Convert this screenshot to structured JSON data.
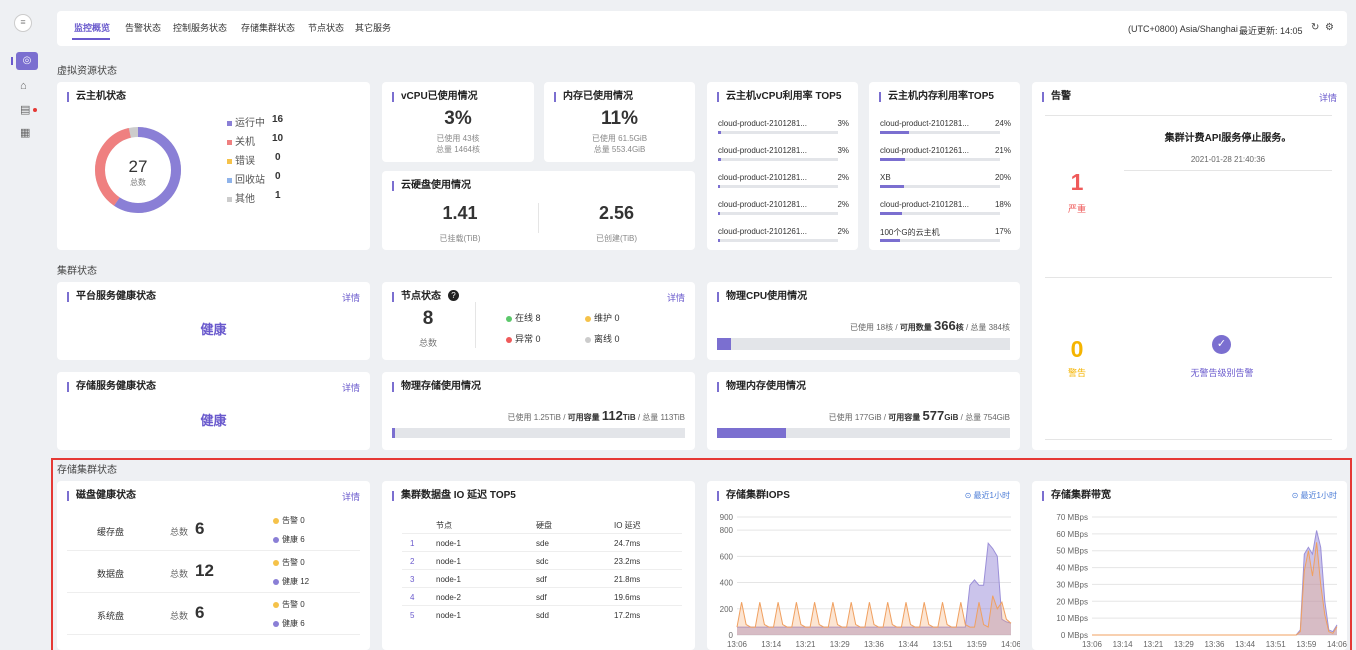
{
  "nav": {
    "tabs": [
      "监控概览",
      "告警状态",
      "控制服务状态",
      "存储集群状态",
      "节点状态",
      "其它服务"
    ],
    "timezone": "(UTC+0800) Asia/Shanghai",
    "update_label": "最近更新: 14:05"
  },
  "sections": {
    "virtual": "虚拟资源状态",
    "cluster": "集群状态",
    "storage": "存储集群状态"
  },
  "vm": {
    "title": "云主机状态",
    "total": "27",
    "total_label": "总数",
    "legend": [
      {
        "label": "运行中",
        "value": "16",
        "color": "#8a7fd6"
      },
      {
        "label": "关机",
        "value": "10",
        "color": "#ef8080"
      },
      {
        "label": "错误",
        "value": "0",
        "color": "#f5c24a"
      },
      {
        "label": "回收站",
        "value": "0",
        "color": "#8fb3ea"
      },
      {
        "label": "其他",
        "value": "1",
        "color": "#cccccc"
      }
    ]
  },
  "vcpu": {
    "title": "vCPU已使用情况",
    "pct": "3%",
    "used": "已使用 43核",
    "total": "总量 1464核"
  },
  "mem": {
    "title": "内存已使用情况",
    "pct": "11%",
    "used": "已使用 61.5GiB",
    "total": "总量 553.4GiB"
  },
  "disk": {
    "title": "云硬盘使用情况",
    "mounted": "1.41",
    "mounted_label": "已挂载(TiB)",
    "created": "2.56",
    "created_label": "已创建(TiB)"
  },
  "top_cpu": {
    "title": "云主机vCPU利用率 TOP5",
    "items": [
      {
        "name": "cloud-product-2101281...",
        "pct": "3%",
        "frac": 0.03
      },
      {
        "name": "cloud-product-2101281...",
        "pct": "3%",
        "frac": 0.03
      },
      {
        "name": "cloud-product-2101281...",
        "pct": "2%",
        "frac": 0.02
      },
      {
        "name": "cloud-product-2101281...",
        "pct": "2%",
        "frac": 0.02
      },
      {
        "name": "cloud-product-2101261...",
        "pct": "2%",
        "frac": 0.02
      }
    ]
  },
  "top_mem": {
    "title": "云主机内存利用率TOP5",
    "items": [
      {
        "name": "cloud-product-2101281...",
        "pct": "24%",
        "frac": 0.24
      },
      {
        "name": "cloud-product-2101261...",
        "pct": "21%",
        "frac": 0.21
      },
      {
        "name": "XB",
        "pct": "20%",
        "frac": 0.2
      },
      {
        "name": "cloud-product-2101281...",
        "pct": "18%",
        "frac": 0.18
      },
      {
        "name": "100个G的云主机",
        "pct": "17%",
        "frac": 0.17
      }
    ]
  },
  "alarm": {
    "title": "告警",
    "detail": "详情",
    "severe_count": "1",
    "severe_label": "严重",
    "message": "集群计费API服务停止服务。",
    "time": "2021-01-28 21:40:36",
    "warn_count": "0",
    "warn_label": "警告",
    "no_warn": "无警告级别告警"
  },
  "platform": {
    "title": "平台服务健康状态",
    "detail": "详情",
    "status": "健康"
  },
  "storage_svc": {
    "title": "存储服务健康状态",
    "detail": "详情",
    "status": "健康"
  },
  "node": {
    "title": "节点状态",
    "detail": "详情",
    "total": "8",
    "total_label": "总数",
    "online": "在线 8",
    "maintain": "维护 0",
    "abnormal": "异常 0",
    "offline": "离线 0"
  },
  "pcpu": {
    "title": "物理CPU使用情况",
    "used": "已使用 18核 / ",
    "avail_label": "可用数量 ",
    "avail": "366",
    "avail_unit": "核",
    "total": " / 总量 384核",
    "frac": 0.047
  },
  "pstore": {
    "title": "物理存储使用情况",
    "used": "已使用 1.25TiB / ",
    "avail_label": "可用容量 ",
    "avail": "112",
    "avail_unit": "TiB",
    "total": " / 总量 113TiB",
    "frac": 0.011
  },
  "pmem": {
    "title": "物理内存使用情况",
    "used": "已使用 177GiB / ",
    "avail_label": "可用容量 ",
    "avail": "577",
    "avail_unit": "GiB",
    "total": " / 总量 754GiB",
    "frac": 0.235
  },
  "diskhealth": {
    "title": "磁盘健康状态",
    "detail": "详情",
    "rows": [
      {
        "name": "缓存盘",
        "total_label": "总数",
        "total": "6",
        "warn": "告警 0",
        "ok": "健康 6"
      },
      {
        "name": "数据盘",
        "total_label": "总数",
        "total": "12",
        "warn": "告警 0",
        "ok": "健康 12"
      },
      {
        "name": "系统盘",
        "total_label": "总数",
        "total": "6",
        "warn": "告警 0",
        "ok": "健康 6"
      }
    ]
  },
  "io": {
    "title": "集群数据盘 IO 延迟 TOP5",
    "headers": [
      "节点",
      "硬盘",
      "IO 延迟"
    ],
    "rows": [
      {
        "rank": "1",
        "node": "node-1",
        "disk": "sde",
        "lat": "24.7ms"
      },
      {
        "rank": "2",
        "node": "node-1",
        "disk": "sdc",
        "lat": "23.2ms"
      },
      {
        "rank": "3",
        "node": "node-1",
        "disk": "sdf",
        "lat": "21.8ms"
      },
      {
        "rank": "4",
        "node": "node-2",
        "disk": "sdf",
        "lat": "19.6ms"
      },
      {
        "rank": "5",
        "node": "node-1",
        "disk": "sdd",
        "lat": "17.2ms"
      }
    ]
  },
  "iops_card": {
    "title": "存储集群IOPS",
    "range": "最近1小时"
  },
  "bw_card": {
    "title": "存储集群带宽",
    "range": "最近1小时"
  },
  "colors": {
    "accent": "#6a5acd",
    "severe": "#ef5a5a",
    "warn": "#f5b400",
    "highlight": "#e53935"
  },
  "chart_data": [
    {
      "type": "area",
      "title": "存储集群IOPS",
      "x": [
        "13:06",
        "13:14",
        "13:21",
        "13:29",
        "13:36",
        "13:44",
        "13:51",
        "13:59",
        "14:06"
      ],
      "ylim": [
        0,
        900
      ],
      "yticks": [
        0,
        200,
        400,
        600,
        800,
        900
      ],
      "series": [
        {
          "values": [
            60,
            60,
            60,
            60,
            60,
            60,
            60,
            60,
            60,
            60,
            60,
            60,
            60,
            60,
            60,
            60,
            60,
            60,
            60,
            60,
            60,
            60,
            60,
            60,
            60,
            60,
            60,
            60,
            60,
            60,
            60,
            60,
            60,
            60,
            60,
            60,
            60,
            60,
            60,
            60,
            60,
            60,
            60,
            60,
            60,
            60,
            60,
            60,
            60,
            60,
            60,
            380,
            420,
            380,
            380,
            700,
            660,
            600,
            120,
            100,
            90
          ]
        },
        {
          "values": [
            60,
            250,
            80,
            60,
            60,
            250,
            80,
            60,
            60,
            250,
            80,
            60,
            60,
            250,
            80,
            60,
            60,
            250,
            80,
            60,
            60,
            250,
            80,
            60,
            60,
            250,
            80,
            60,
            60,
            250,
            80,
            60,
            60,
            250,
            80,
            60,
            60,
            250,
            80,
            60,
            60,
            250,
            80,
            60,
            60,
            250,
            80,
            60,
            60,
            250,
            80,
            60,
            60,
            250,
            80,
            60,
            300,
            200,
            250,
            120,
            90
          ]
        }
      ]
    },
    {
      "type": "area",
      "title": "存储集群带宽",
      "x": [
        "13:06",
        "13:14",
        "13:21",
        "13:29",
        "13:36",
        "13:44",
        "13:51",
        "13:59",
        "14:06"
      ],
      "ylim": [
        0,
        70
      ],
      "yticks": [
        "0 MBps",
        "10 MBps",
        "20 MBps",
        "30 MBps",
        "40 MBps",
        "50 MBps",
        "60 MBps",
        "70 MBps"
      ],
      "series": [
        {
          "values": [
            0,
            0,
            0,
            0,
            0,
            0,
            0,
            0,
            0,
            0,
            0,
            0,
            0,
            0,
            0,
            0,
            0,
            0,
            0,
            0,
            0,
            0,
            0,
            0,
            0,
            0,
            0,
            0,
            0,
            0,
            0,
            0,
            0,
            0,
            0,
            0,
            0,
            0,
            0,
            0,
            0,
            0,
            0,
            0,
            0,
            0,
            0,
            0,
            0,
            0,
            0,
            3,
            48,
            52,
            48,
            62,
            52,
            20,
            3,
            2,
            6
          ]
        },
        {
          "values": [
            0,
            0,
            0,
            0,
            0,
            0,
            0,
            0,
            0,
            0,
            0,
            0,
            0,
            0,
            0,
            0,
            0,
            0,
            0,
            0,
            0,
            0,
            0,
            0,
            0,
            0,
            0,
            0,
            0,
            0,
            0,
            0,
            0,
            0,
            0,
            0,
            0,
            0,
            0,
            0,
            0,
            0,
            0,
            0,
            0,
            0,
            0,
            0,
            0,
            0,
            0,
            2,
            38,
            50,
            35,
            55,
            30,
            12,
            2,
            1,
            5
          ]
        }
      ]
    }
  ]
}
